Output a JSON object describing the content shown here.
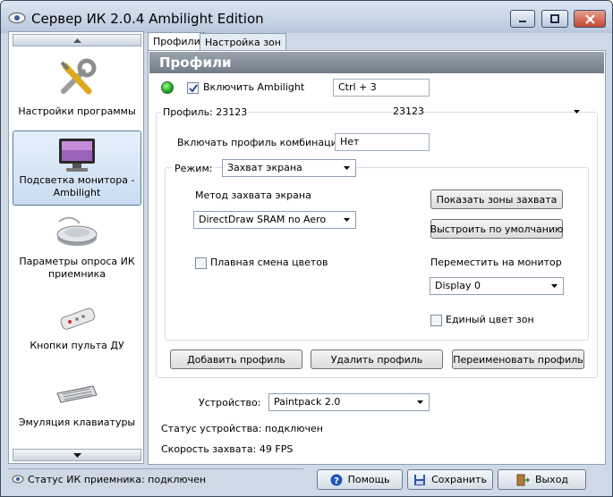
{
  "window": {
    "title": "Сервер ИК 2.0.4 Ambilight Edition"
  },
  "sidebar": {
    "items": [
      {
        "label": "Настройки программы",
        "icon": "tools-icon"
      },
      {
        "label": "Подсветка монитора - Ambilight",
        "icon": "monitor-icon",
        "selected": true
      },
      {
        "label": "Параметры опроса ИК приемника",
        "icon": "ir-receiver-icon"
      },
      {
        "label": "Кнопки пульта ДУ",
        "icon": "remote-control-icon"
      },
      {
        "label": "Эмуляция клавиатуры",
        "icon": "keyboard-icon"
      }
    ]
  },
  "tabs": [
    {
      "label": "Профили",
      "active": true
    },
    {
      "label": "Настройка зон",
      "active": false
    }
  ],
  "panel": {
    "header": "Профили",
    "enable_ambilight": {
      "label": "Включить Ambilight",
      "checked": true
    },
    "hotkey_value": "Ctrl + 3",
    "profile_label": "Профиль: 23123",
    "profile_value": "23123",
    "combo_label": "Включать профиль комбинацией:",
    "combo_value": "Нет",
    "mode_label": "Режим:",
    "mode_value": "Захват экрана",
    "capture_method_label": "Метод захвата экрана",
    "capture_method_value": "DirectDraw SRAM no Aero",
    "show_zones_button": "Показать зоны захвата",
    "defaults_button": "Выстроить по умолчанию",
    "smooth_label": "Плавная смена цветов",
    "smooth_checked": false,
    "move_monitor_label": "Переместить на монитор",
    "monitor_value": "Display 0",
    "single_color_label": "Единый цвет зон",
    "single_color_checked": false,
    "add_profile_button": "Добавить профиль",
    "delete_profile_button": "Удалить профиль",
    "rename_profile_button": "Переименовать профиль",
    "device_label": "Устройство:",
    "device_value": "Paintpack 2.0",
    "device_status": "Статус устройства: подключен",
    "capture_speed": "Скорость захвата: 49 FPS"
  },
  "statusbar": {
    "receiver_status": "Статус ИК приемника: подключен",
    "help_button": "Помощь",
    "save_button": "Сохранить",
    "exit_button": "Выход"
  },
  "colors": {
    "led": "#1fa51f",
    "header": "#838d98",
    "selection": "#c9dcf1"
  }
}
